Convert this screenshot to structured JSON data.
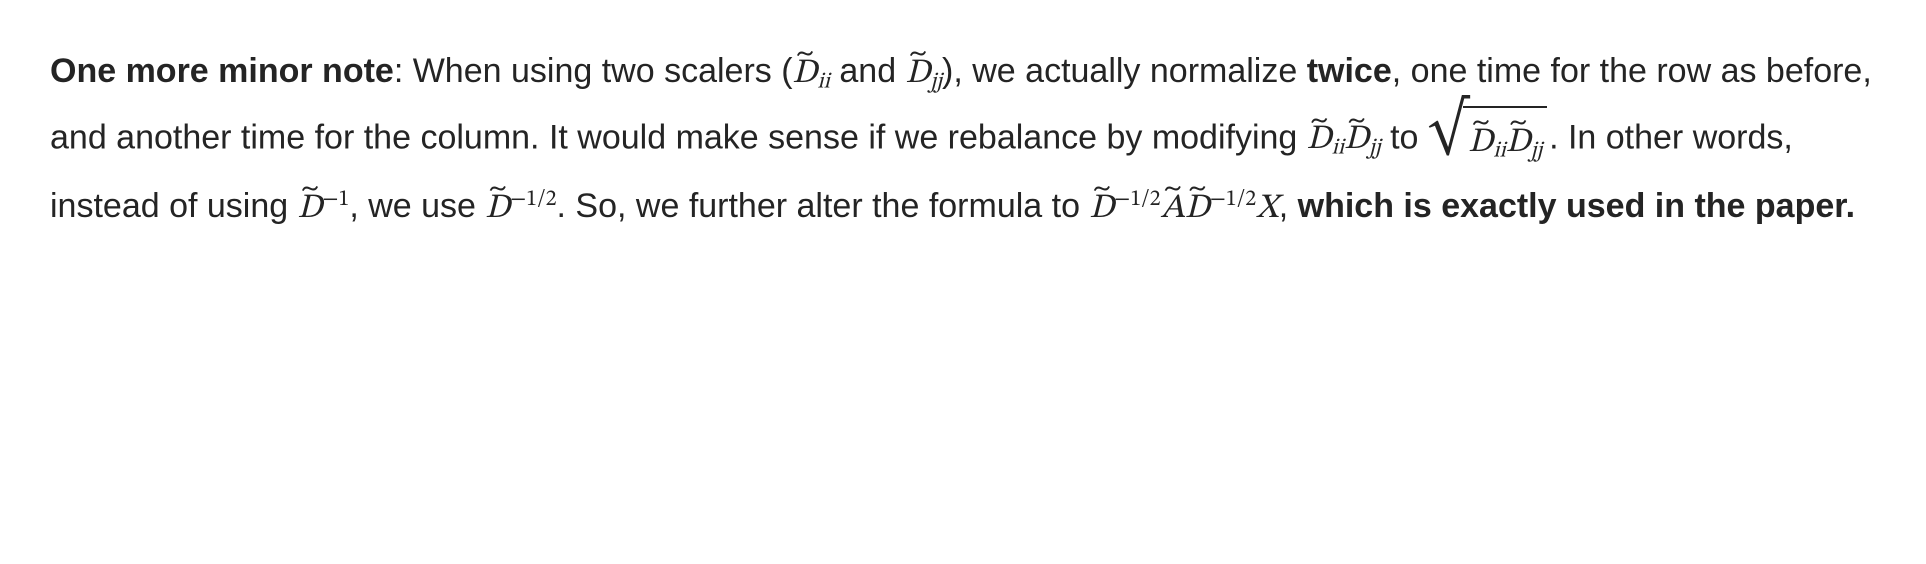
{
  "paragraph": {
    "lead_bold": "One more minor note",
    "t1": ": When using two scalers (",
    "t2": " and ",
    "t3": "), we actually normalize ",
    "twice": "twice",
    "t4": ", one time for the row as before, and another time for the column. It would make sense if we rebalance by modifying ",
    "t5": " to ",
    "t6": ". In other words, instead of using ",
    "t7": ", we use ",
    "t8": ". So, we further alter the formula to ",
    "t9": ", ",
    "conclusion": "which is exactly used in the paper."
  },
  "math": {
    "D": "D",
    "A": "A",
    "X": "X",
    "ii": "ii",
    "jj": "jj",
    "neg1": "−1",
    "neghalf": "−1/2",
    "tilde": "~"
  }
}
